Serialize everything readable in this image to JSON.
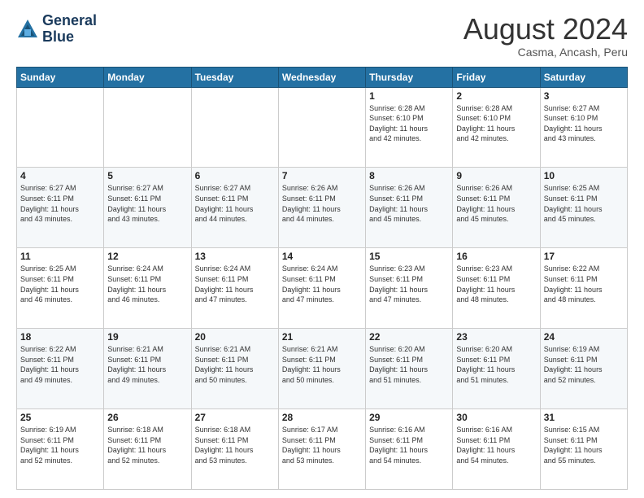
{
  "logo": {
    "line1": "General",
    "line2": "Blue"
  },
  "title": "August 2024",
  "subtitle": "Casma, Ancash, Peru",
  "days_header": [
    "Sunday",
    "Monday",
    "Tuesday",
    "Wednesday",
    "Thursday",
    "Friday",
    "Saturday"
  ],
  "weeks": [
    [
      {
        "day": "",
        "info": ""
      },
      {
        "day": "",
        "info": ""
      },
      {
        "day": "",
        "info": ""
      },
      {
        "day": "",
        "info": ""
      },
      {
        "day": "1",
        "info": "Sunrise: 6:28 AM\nSunset: 6:10 PM\nDaylight: 11 hours\nand 42 minutes."
      },
      {
        "day": "2",
        "info": "Sunrise: 6:28 AM\nSunset: 6:10 PM\nDaylight: 11 hours\nand 42 minutes."
      },
      {
        "day": "3",
        "info": "Sunrise: 6:27 AM\nSunset: 6:10 PM\nDaylight: 11 hours\nand 43 minutes."
      }
    ],
    [
      {
        "day": "4",
        "info": "Sunrise: 6:27 AM\nSunset: 6:11 PM\nDaylight: 11 hours\nand 43 minutes."
      },
      {
        "day": "5",
        "info": "Sunrise: 6:27 AM\nSunset: 6:11 PM\nDaylight: 11 hours\nand 43 minutes."
      },
      {
        "day": "6",
        "info": "Sunrise: 6:27 AM\nSunset: 6:11 PM\nDaylight: 11 hours\nand 44 minutes."
      },
      {
        "day": "7",
        "info": "Sunrise: 6:26 AM\nSunset: 6:11 PM\nDaylight: 11 hours\nand 44 minutes."
      },
      {
        "day": "8",
        "info": "Sunrise: 6:26 AM\nSunset: 6:11 PM\nDaylight: 11 hours\nand 45 minutes."
      },
      {
        "day": "9",
        "info": "Sunrise: 6:26 AM\nSunset: 6:11 PM\nDaylight: 11 hours\nand 45 minutes."
      },
      {
        "day": "10",
        "info": "Sunrise: 6:25 AM\nSunset: 6:11 PM\nDaylight: 11 hours\nand 45 minutes."
      }
    ],
    [
      {
        "day": "11",
        "info": "Sunrise: 6:25 AM\nSunset: 6:11 PM\nDaylight: 11 hours\nand 46 minutes."
      },
      {
        "day": "12",
        "info": "Sunrise: 6:24 AM\nSunset: 6:11 PM\nDaylight: 11 hours\nand 46 minutes."
      },
      {
        "day": "13",
        "info": "Sunrise: 6:24 AM\nSunset: 6:11 PM\nDaylight: 11 hours\nand 47 minutes."
      },
      {
        "day": "14",
        "info": "Sunrise: 6:24 AM\nSunset: 6:11 PM\nDaylight: 11 hours\nand 47 minutes."
      },
      {
        "day": "15",
        "info": "Sunrise: 6:23 AM\nSunset: 6:11 PM\nDaylight: 11 hours\nand 47 minutes."
      },
      {
        "day": "16",
        "info": "Sunrise: 6:23 AM\nSunset: 6:11 PM\nDaylight: 11 hours\nand 48 minutes."
      },
      {
        "day": "17",
        "info": "Sunrise: 6:22 AM\nSunset: 6:11 PM\nDaylight: 11 hours\nand 48 minutes."
      }
    ],
    [
      {
        "day": "18",
        "info": "Sunrise: 6:22 AM\nSunset: 6:11 PM\nDaylight: 11 hours\nand 49 minutes."
      },
      {
        "day": "19",
        "info": "Sunrise: 6:21 AM\nSunset: 6:11 PM\nDaylight: 11 hours\nand 49 minutes."
      },
      {
        "day": "20",
        "info": "Sunrise: 6:21 AM\nSunset: 6:11 PM\nDaylight: 11 hours\nand 50 minutes."
      },
      {
        "day": "21",
        "info": "Sunrise: 6:21 AM\nSunset: 6:11 PM\nDaylight: 11 hours\nand 50 minutes."
      },
      {
        "day": "22",
        "info": "Sunrise: 6:20 AM\nSunset: 6:11 PM\nDaylight: 11 hours\nand 51 minutes."
      },
      {
        "day": "23",
        "info": "Sunrise: 6:20 AM\nSunset: 6:11 PM\nDaylight: 11 hours\nand 51 minutes."
      },
      {
        "day": "24",
        "info": "Sunrise: 6:19 AM\nSunset: 6:11 PM\nDaylight: 11 hours\nand 52 minutes."
      }
    ],
    [
      {
        "day": "25",
        "info": "Sunrise: 6:19 AM\nSunset: 6:11 PM\nDaylight: 11 hours\nand 52 minutes."
      },
      {
        "day": "26",
        "info": "Sunrise: 6:18 AM\nSunset: 6:11 PM\nDaylight: 11 hours\nand 52 minutes."
      },
      {
        "day": "27",
        "info": "Sunrise: 6:18 AM\nSunset: 6:11 PM\nDaylight: 11 hours\nand 53 minutes."
      },
      {
        "day": "28",
        "info": "Sunrise: 6:17 AM\nSunset: 6:11 PM\nDaylight: 11 hours\nand 53 minutes."
      },
      {
        "day": "29",
        "info": "Sunrise: 6:16 AM\nSunset: 6:11 PM\nDaylight: 11 hours\nand 54 minutes."
      },
      {
        "day": "30",
        "info": "Sunrise: 6:16 AM\nSunset: 6:11 PM\nDaylight: 11 hours\nand 54 minutes."
      },
      {
        "day": "31",
        "info": "Sunrise: 6:15 AM\nSunset: 6:11 PM\nDaylight: 11 hours\nand 55 minutes."
      }
    ]
  ]
}
